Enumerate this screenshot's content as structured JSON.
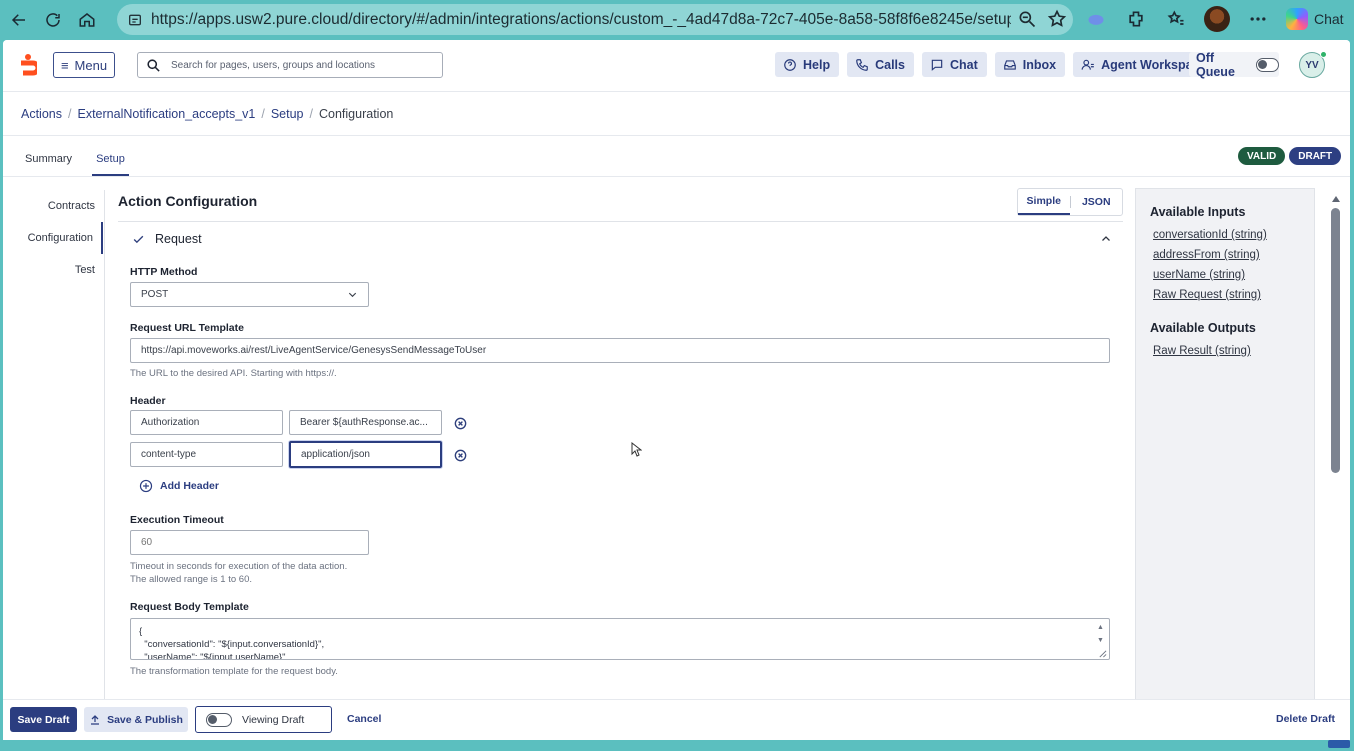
{
  "browser": {
    "url": "https://apps.usw2.pure.cloud/directory/#/admin/integrations/actions/custom_-_4ad47d8a-72c7-405e-8a58-58f8f6e8245e/setup/...",
    "copilot_label": "Chat"
  },
  "topbar": {
    "menu_label": "Menu",
    "search_placeholder": "Search for pages, users, groups and locations",
    "actions": [
      "Help",
      "Calls",
      "Chat",
      "Inbox",
      "Agent Workspace"
    ],
    "queue_label": "Off Queue",
    "avatar_initials": "YV"
  },
  "breadcrumb": {
    "items": [
      "Actions",
      "ExternalNotification_accepts_v1",
      "Setup"
    ],
    "current": "Configuration"
  },
  "tabs": [
    "Summary",
    "Setup"
  ],
  "badges": {
    "valid": "VALID",
    "draft": "DRAFT"
  },
  "subnav": [
    "Contracts",
    "Configuration",
    "Test"
  ],
  "main": {
    "title": "Action Configuration",
    "mode_simple": "Simple",
    "mode_json": "JSON",
    "section_title": "Request",
    "http_method_label": "HTTP Method",
    "http_method_value": "POST",
    "url_label": "Request URL Template",
    "url_value": "https://api.moveworks.ai/rest/LiveAgentService/GenesysSendMessageToUser",
    "url_hint": "The URL to the desired API. Starting with https://.",
    "header_label": "Header",
    "headers": [
      {
        "key": "Authorization",
        "value": "Bearer ${authResponse.ac..."
      },
      {
        "key": "content-type",
        "value": "application/json"
      }
    ],
    "add_header_label": "Add Header",
    "timeout_label": "Execution Timeout",
    "timeout_placeholder": "60",
    "timeout_hint_1": "Timeout in seconds for execution of the data action.",
    "timeout_hint_2": "The allowed range is 1 to 60.",
    "body_label": "Request Body Template",
    "body_lines": [
      "{",
      "  \"conversationId\": \"${input.conversationId}\",",
      "  \"userName\": \"${input.userName}\","
    ],
    "body_hint": "The transformation template for the request body."
  },
  "side_panel": {
    "inputs_title": "Available Inputs",
    "inputs": [
      "conversationId (string)",
      "addressFrom (string)",
      "userName (string)",
      "Raw Request (string)"
    ],
    "outputs_title": "Available Outputs",
    "outputs": [
      "Raw Result (string)"
    ]
  },
  "footer": {
    "save_draft": "Save Draft",
    "save_publish": "Save & Publish",
    "viewing_draft": "Viewing Draft",
    "cancel": "Cancel",
    "delete_draft": "Delete Draft"
  },
  "colors": {
    "primary": "#2b3d80",
    "valid": "#1e5b3f",
    "browser": "#5bbfbf"
  }
}
